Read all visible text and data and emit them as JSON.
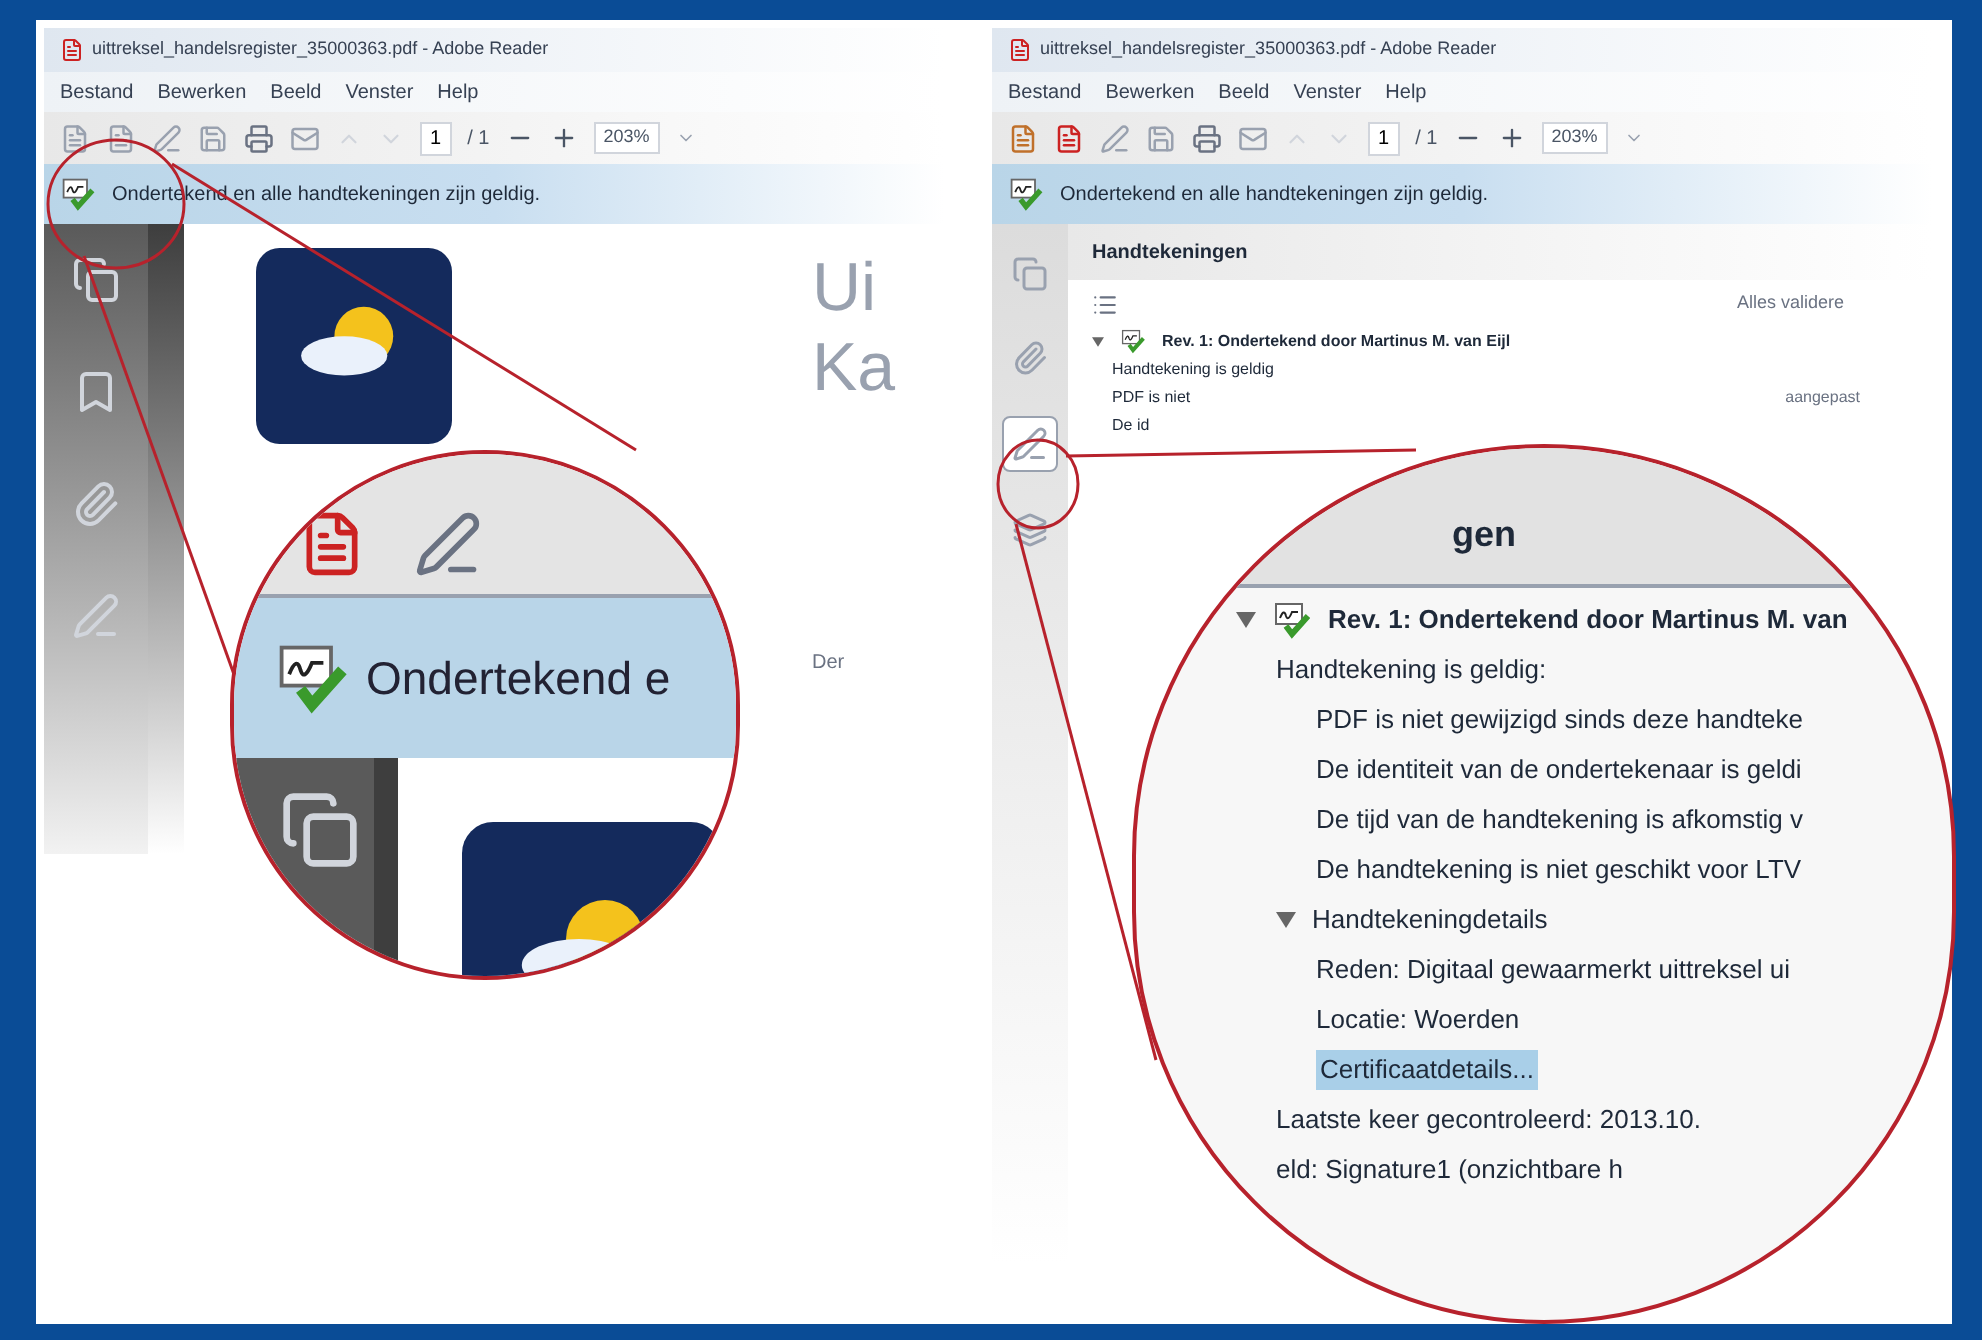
{
  "left_window": {
    "title": "uittreksel_handelsregister_35000363.pdf - Adobe Reader",
    "menu": [
      "Bestand",
      "Bewerken",
      "Beeld",
      "Venster",
      "Help"
    ],
    "toolbar": {
      "page": "1",
      "page_count": "/ 1",
      "zoom": "203%"
    },
    "signature_bar": "Ondertekend en alle handtekeningen zijn geldig.",
    "document": {
      "heading_lines": [
        "Ui",
        "Ka"
      ],
      "text": "Der"
    }
  },
  "left_magnifier": {
    "signature_bar": "Ondertekend e"
  },
  "right_window": {
    "title": "uittreksel_handelsregister_35000363.pdf - Adobe Reader",
    "menu": [
      "Bestand",
      "Bewerken",
      "Beeld",
      "Venster",
      "Help"
    ],
    "toolbar": {
      "page": "1",
      "page_count": "/ 1",
      "zoom": "203%"
    },
    "signature_bar": "Ondertekend en alle handtekeningen zijn geldig.",
    "sidebar": [
      {
        "kind": "pages",
        "selected": false
      },
      {
        "kind": "attachments",
        "selected": false
      },
      {
        "kind": "signatures",
        "selected": true
      },
      {
        "kind": "layers",
        "selected": false
      }
    ],
    "signatures_panel": {
      "title": "Handtekeningen",
      "validate_all": "Alles validere",
      "tree": [
        {
          "label": "Rev. 1: Ondertekend door Martinus M. van Eijl",
          "expanded": true,
          "children": [
            {
              "label": "Handtekening is geldig"
            },
            {
              "label": "PDF is niet",
              "note": "aangepast"
            },
            {
              "label": "De id"
            }
          ]
        }
      ]
    }
  },
  "right_magnifier": {
    "header": "gen",
    "tree": [
      {
        "label": "Rev. 1: Ondertekend door Martinus M. van",
        "expanded": true,
        "children": [
          {
            "label": "Handtekening is geldig:",
            "children": [
              {
                "label": "PDF is niet gewijzigd sinds deze handteke"
              },
              {
                "label": "De identiteit van de ondertekenaar is geldi"
              },
              {
                "label": "De tijd van de handtekening is afkomstig v"
              },
              {
                "label": "De handtekening is niet geschikt voor LTV"
              }
            ]
          },
          {
            "label": "Handtekeningdetails",
            "expanded": true,
            "children": [
              {
                "label": "Reden: Digitaal gewaarmerkt uittreksel ui",
                "selected": false
              },
              {
                "label": "Locatie: Woerden",
                "selected": false
              },
              {
                "label": "Certificaatdetails...",
                "selected": true
              }
            ]
          },
          {
            "label": "Laatste keer gecontroleerd: 2013.10."
          },
          {
            "label": "eld: Signature1 (onzichtbare h"
          }
        ]
      }
    ]
  }
}
